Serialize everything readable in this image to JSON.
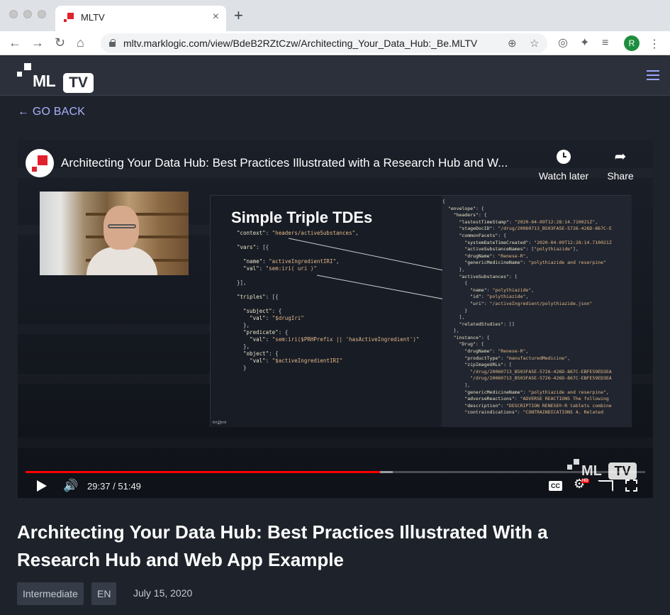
{
  "browser": {
    "tab_title": "MLTV",
    "tab_close": "×",
    "new_tab": "+",
    "url": "mltv.marklogic.com/view/BdeB2RZtCzw/Architecting_Your_Data_Hub:_Be.MLTV",
    "profile_initial": "R"
  },
  "site": {
    "logo_ml": "ML",
    "logo_tv": "TV",
    "go_back": "← GO BACK"
  },
  "player": {
    "video_title": "Architecting Your Data Hub: Best Practices Illustrated with a Research Hub and W...",
    "watch_later": "Watch later",
    "share": "Share",
    "slide_title": "Simple Triple TDEs",
    "time": "29:37 / 51:49",
    "progress_fraction": 0.5716,
    "buffer_fraction": 0.5925,
    "cc_label": "CC",
    "hd_badge": "HD",
    "watermark_ml": "ML",
    "watermark_tv": "TV"
  },
  "page": {
    "title": "Architecting Your Data Hub: Best Practices Illustrated With a Research Hub and Web App Example",
    "tags": [
      "Intermediate",
      "EN"
    ],
    "date": "July 15, 2020"
  },
  "colors": {
    "accent_link": "#a8b1ff",
    "progress_red": "#ff0000",
    "page_bg": "#1e232b"
  }
}
